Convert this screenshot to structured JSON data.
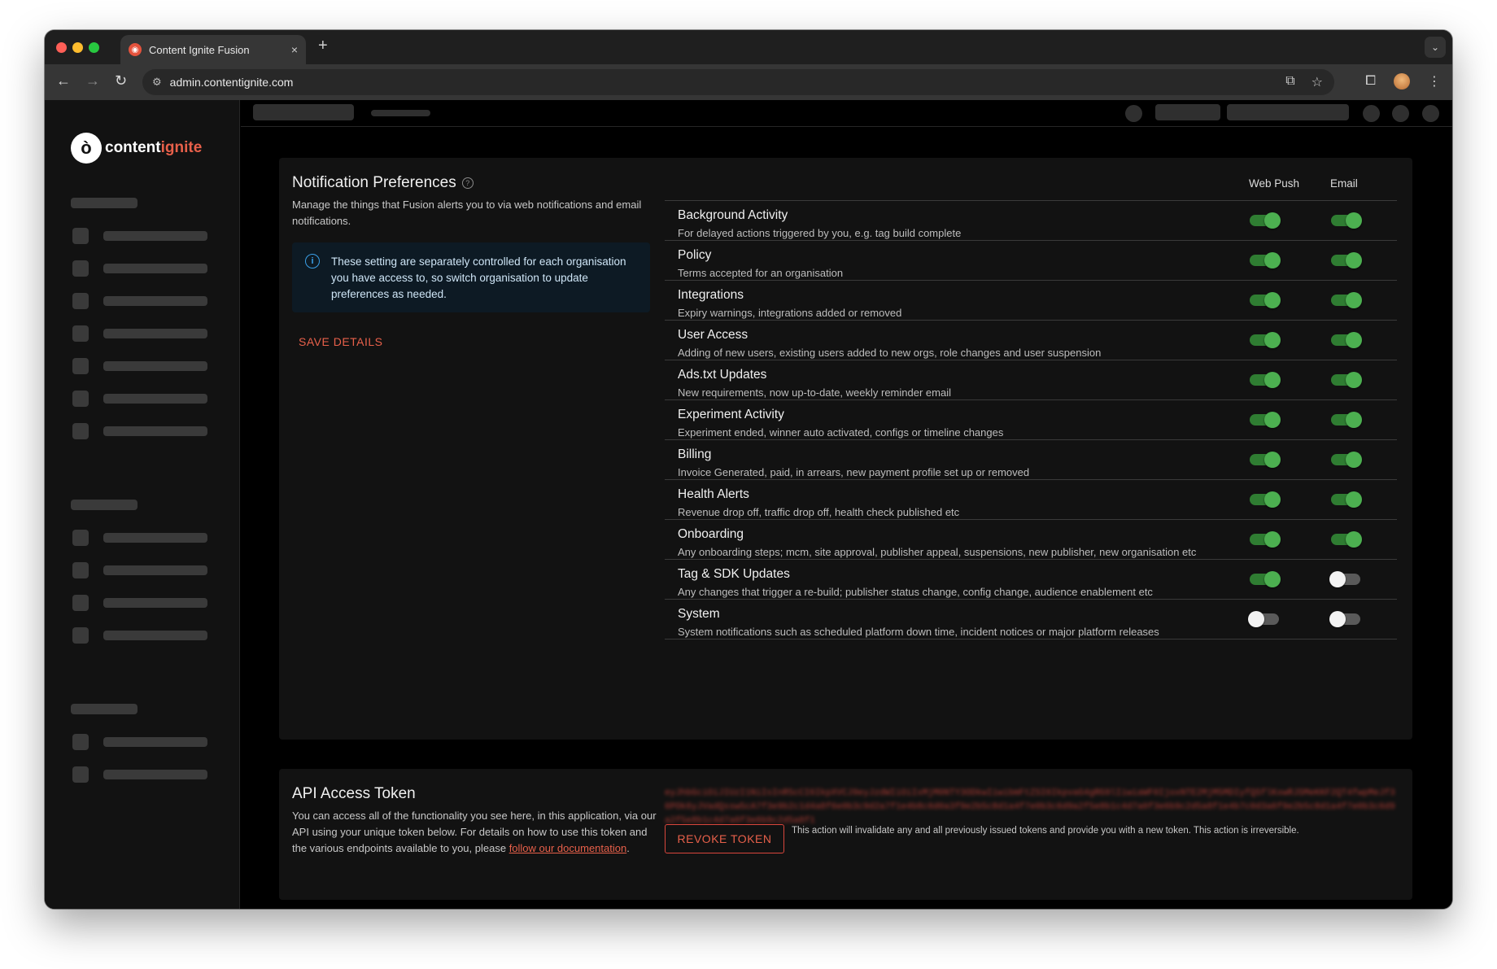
{
  "browser": {
    "tab_title": "Content Ignite Fusion",
    "url": "admin.contentignite.com",
    "tab_close": "×",
    "new_tab": "+"
  },
  "logo": {
    "text_main": "content",
    "text_accent": "ignite",
    "mark": "ò"
  },
  "notifications": {
    "title": "Notification Preferences",
    "description": "Manage the things that Fusion alerts you to via web notifications and email notifications.",
    "info": "These setting are separately controlled for each organisation you have access to, so switch organisation to update preferences as needed.",
    "save_label": "SAVE DETAILS",
    "col_web": "Web Push",
    "col_email": "Email",
    "items": [
      {
        "title": "Background Activity",
        "desc": "For delayed actions triggered by you, e.g. tag build complete",
        "web": true,
        "email": true
      },
      {
        "title": "Policy",
        "desc": "Terms accepted for an organisation",
        "web": true,
        "email": true
      },
      {
        "title": "Integrations",
        "desc": "Expiry warnings, integrations added or removed",
        "web": true,
        "email": true
      },
      {
        "title": "User Access",
        "desc": "Adding of new users, existing users added to new orgs, role changes and user suspension",
        "web": true,
        "email": true
      },
      {
        "title": "Ads.txt Updates",
        "desc": "New requirements, now up-to-date, weekly reminder email",
        "web": true,
        "email": true
      },
      {
        "title": "Experiment Activity",
        "desc": "Experiment ended, winner auto activated, configs or timeline changes",
        "web": true,
        "email": true
      },
      {
        "title": "Billing",
        "desc": "Invoice Generated, paid, in arrears, new payment profile set up or removed",
        "web": true,
        "email": true
      },
      {
        "title": "Health Alerts",
        "desc": "Revenue drop off, traffic drop off, health check published etc",
        "web": true,
        "email": true
      },
      {
        "title": "Onboarding",
        "desc": "Any onboarding steps; mcm, site approval, publisher appeal, suspensions, new publisher, new organisation etc",
        "web": true,
        "email": true
      },
      {
        "title": "Tag & SDK Updates",
        "desc": "Any changes that trigger a re-build; publisher status change, config change, audience enablement etc",
        "web": true,
        "email": false
      },
      {
        "title": "System",
        "desc": "System notifications such as scheduled platform down time, incident notices or major platform releases",
        "web": false,
        "email": false
      }
    ]
  },
  "api": {
    "title": "API Access Token",
    "description_pre": "You can access all of the functionality you see here, in this application, via our API using your unique token below. For details on how to use this token and the various endpoints available to you, please ",
    "doc_link": "follow our documentation",
    "description_post": ".",
    "revoke_label": "REVOKE TOKEN",
    "revoke_note": "This action will invalidate any and all previously issued tokens and provide you with a new token. This action is irreversible."
  },
  "colors": {
    "accent": "#e8604a",
    "toggle_on": "#4caf50",
    "toggle_off": "#f2f2f2",
    "info_bg": "#0d1a24"
  }
}
